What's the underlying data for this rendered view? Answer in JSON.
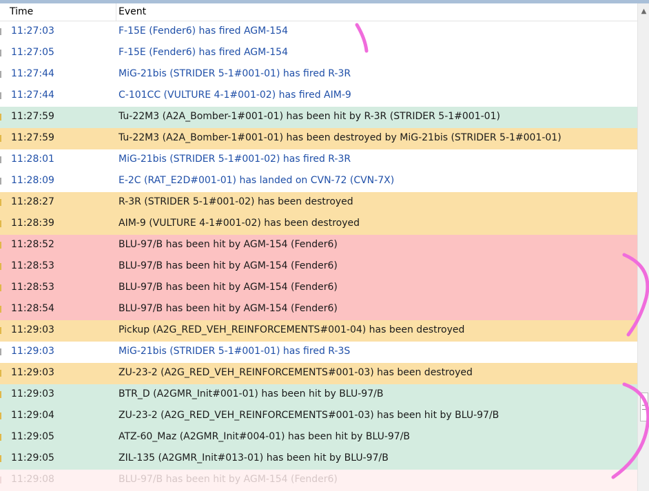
{
  "header": {
    "time_label": "Time",
    "event_label": "Event"
  },
  "colors": {
    "fired_text": "#1f4fa8",
    "normal_text": "#1a1a1a",
    "hit_bg": "#d4ece0",
    "destroyed_bg": "#fbe0a6",
    "weapon_hit_bg": "#fcc2c2",
    "annotation": "#f06cdc"
  },
  "rows": [
    {
      "time": "11:27:03",
      "event": "F-15E (Fender6) has fired AGM-154",
      "kind": "fired"
    },
    {
      "time": "11:27:05",
      "event": "F-15E (Fender6) has fired AGM-154",
      "kind": "fired"
    },
    {
      "time": "11:27:44",
      "event": "MiG-21bis (STRIDER 5-1#001-01) has fired R-3R",
      "kind": "fired"
    },
    {
      "time": "11:27:44",
      "event": "C-101CC (VULTURE 4-1#001-02) has fired AIM-9",
      "kind": "fired"
    },
    {
      "time": "11:27:59",
      "event": "Tu-22M3 (A2A_Bomber-1#001-01) has been hit by R-3R (STRIDER 5-1#001-01)",
      "kind": "hit"
    },
    {
      "time": "11:27:59",
      "event": "Tu-22M3 (A2A_Bomber-1#001-01) has been destroyed by MiG-21bis (STRIDER 5-1#001-01)",
      "kind": "destroyed"
    },
    {
      "time": "11:28:01",
      "event": "MiG-21bis (STRIDER 5-1#001-02) has fired R-3R",
      "kind": "fired"
    },
    {
      "time": "11:28:09",
      "event": "E-2C (RAT_E2D#001-01) has landed on CVN-72 (CVN-7X)",
      "kind": "fired"
    },
    {
      "time": "11:28:27",
      "event": "R-3R (STRIDER 5-1#001-02) has been destroyed",
      "kind": "destroyed"
    },
    {
      "time": "11:28:39",
      "event": "AIM-9 (VULTURE 4-1#001-02) has been destroyed",
      "kind": "destroyed"
    },
    {
      "time": "11:28:52",
      "event": "BLU-97/B has been hit by AGM-154 (Fender6)",
      "kind": "weapon_hit"
    },
    {
      "time": "11:28:53",
      "event": "BLU-97/B has been hit by AGM-154 (Fender6)",
      "kind": "weapon_hit"
    },
    {
      "time": "11:28:53",
      "event": "BLU-97/B has been hit by AGM-154 (Fender6)",
      "kind": "weapon_hit"
    },
    {
      "time": "11:28:54",
      "event": "BLU-97/B has been hit by AGM-154 (Fender6)",
      "kind": "weapon_hit"
    },
    {
      "time": "11:29:03",
      "event": "Pickup (A2G_RED_VEH_REINFORCEMENTS#001-04) has been destroyed",
      "kind": "destroyed"
    },
    {
      "time": "11:29:03",
      "event": "MiG-21bis (STRIDER 5-1#001-01) has fired R-3S",
      "kind": "fired"
    },
    {
      "time": "11:29:03",
      "event": "ZU-23-2 (A2G_RED_VEH_REINFORCEMENTS#001-03) has been destroyed",
      "kind": "destroyed"
    },
    {
      "time": "11:29:03",
      "event": "BTR_D (A2GMR_Init#001-01) has been hit by BLU-97/B",
      "kind": "hit"
    },
    {
      "time": "11:29:04",
      "event": "ZU-23-2 (A2G_RED_VEH_REINFORCEMENTS#001-03) has been hit by BLU-97/B",
      "kind": "hit"
    },
    {
      "time": "11:29:05",
      "event": "ATZ-60_Maz (A2GMR_Init#004-01) has been hit by BLU-97/B",
      "kind": "hit"
    },
    {
      "time": "11:29:05",
      "event": "ZIL-135 (A2GMR_Init#013-01) has been hit by BLU-97/B",
      "kind": "hit"
    },
    {
      "time": "11:29:08",
      "event": "BLU-97/B has been hit by AGM-154 (Fender6)",
      "kind": "weapon_hit_partial"
    }
  ],
  "scrollbar": {
    "up_icon": "chevron-up-icon",
    "thumb_icon": "grip-icon"
  }
}
